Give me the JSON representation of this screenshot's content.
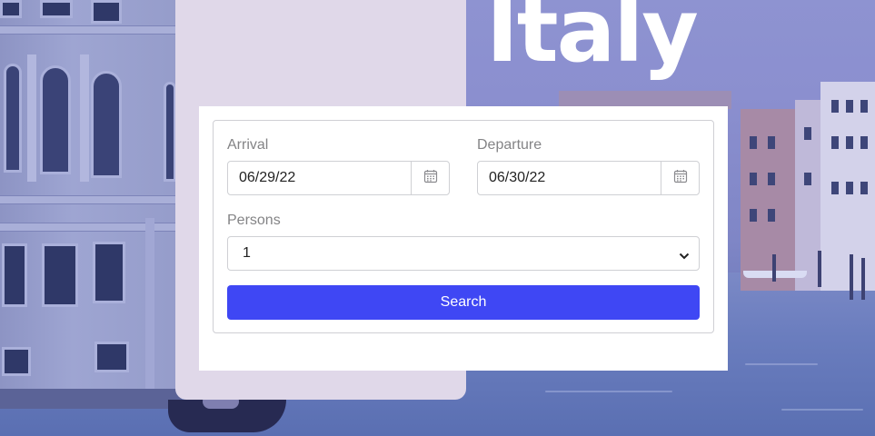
{
  "hero": {
    "title": "Italy"
  },
  "form": {
    "arrival": {
      "label": "Arrival",
      "value": "06/29/22"
    },
    "departure": {
      "label": "Departure",
      "value": "06/30/22"
    },
    "persons": {
      "label": "Persons",
      "value": "1"
    },
    "search_label": "Search"
  },
  "icons": {
    "calendar": "calendar-icon",
    "chevron": "chevron-down-icon"
  },
  "colors": {
    "button": "#3f47f4",
    "panel": "#e0d8e9",
    "tint": "#8e93d1"
  }
}
